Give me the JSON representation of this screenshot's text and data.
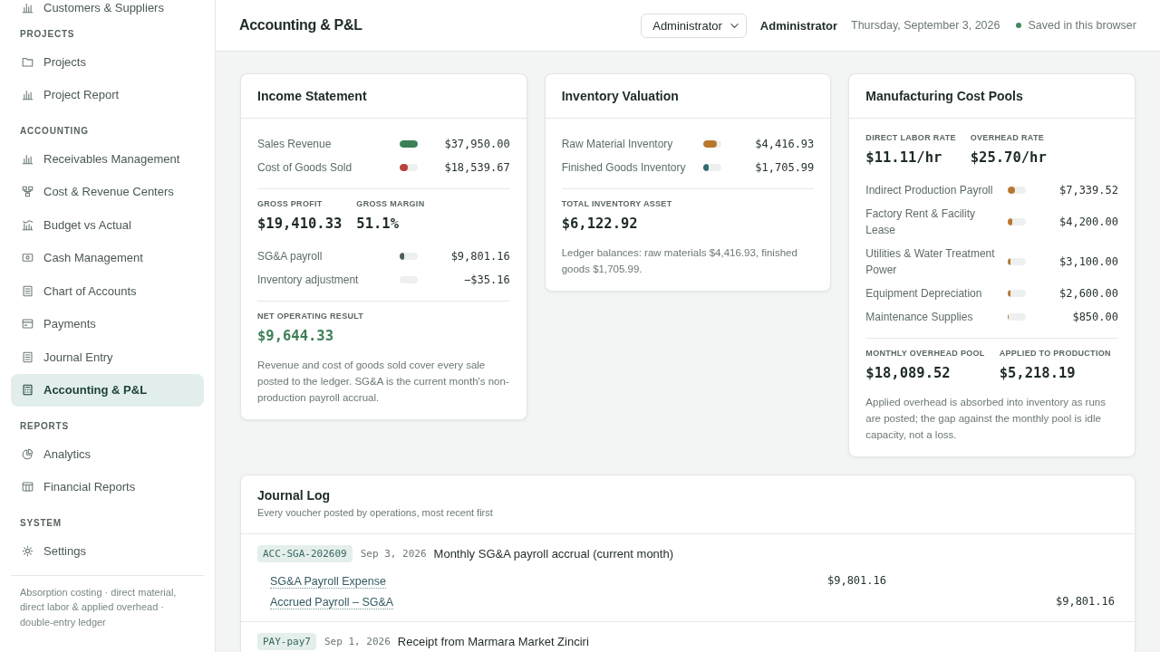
{
  "sidebar": {
    "sections": [
      {
        "items": [
          {
            "label": "Customers & Suppliers",
            "selected": false
          }
        ]
      },
      {
        "title": "PROJECTS",
        "items": [
          {
            "label": "Projects",
            "selected": false
          },
          {
            "label": "Project Report",
            "selected": false
          }
        ]
      },
      {
        "title": "ACCOUNTING",
        "items": [
          {
            "label": "Receivables Management",
            "selected": false
          },
          {
            "label": "Cost & Revenue Centers",
            "selected": false
          },
          {
            "label": "Budget vs Actual",
            "selected": false
          },
          {
            "label": "Cash Management",
            "selected": false
          },
          {
            "label": "Chart of Accounts",
            "selected": false
          },
          {
            "label": "Payments",
            "selected": false
          },
          {
            "label": "Journal Entry",
            "selected": false
          },
          {
            "label": "Accounting & P&L",
            "selected": true
          }
        ]
      },
      {
        "title": "REPORTS",
        "items": [
          {
            "label": "Analytics",
            "selected": false
          },
          {
            "label": "Financial Reports",
            "selected": false
          }
        ]
      },
      {
        "title": "SYSTEM",
        "items": [
          {
            "label": "Settings",
            "selected": false
          }
        ]
      }
    ],
    "footer": "Absorption costing · direct material, direct labor & applied overhead · double-entry ledger"
  },
  "header": {
    "title": "Accounting & P&L",
    "role_select": {
      "value": "Administrator"
    },
    "user": "Administrator",
    "date": "Thursday, September 3, 2026",
    "status": "Saved in this browser"
  },
  "cards": [
    {
      "title": "Income Statement",
      "blocks": [
        {
          "kind": "rows",
          "rows": [
            {
              "label": "Sales Revenue",
              "level": 1,
              "color": "#3d7f57",
              "value": "$37,950.00"
            },
            {
              "label": "Cost of Goods Sold",
              "level": 0.49,
              "color": "#b8433a",
              "value": "$18,539.67"
            }
          ]
        },
        {
          "kind": "stats",
          "stats": [
            {
              "label": "GROSS PROFIT",
              "value": "$19,410.33"
            },
            {
              "label": "GROSS MARGIN",
              "value": "51.1%"
            }
          ]
        },
        {
          "kind": "rows",
          "rows": [
            {
              "label": "SG&A payroll",
              "level": 0.26,
              "color": "#4f5e59",
              "value": "$9,801.16"
            },
            {
              "label": "Inventory adjustment",
              "value": "−$35.16"
            }
          ]
        },
        {
          "kind": "stats",
          "stats": [
            {
              "label": "NET OPERATING RESULT",
              "value": "$9,644.33",
              "color": "#3c7f57"
            }
          ]
        },
        {
          "kind": "note",
          "text": "Revenue and cost of goods sold cover every sale posted to the ledger. SG&A is the current month's non-production payroll accrual."
        }
      ]
    },
    {
      "title": "Inventory Valuation",
      "blocks": [
        {
          "kind": "rows",
          "rows": [
            {
              "label": "Raw Material Inventory",
              "level": 0.72,
              "color": "#b8772e",
              "value": "$4,416.93"
            },
            {
              "label": "Finished Goods Inventory",
              "level": 0.28,
              "color": "#2e6e73",
              "value": "$1,705.99"
            }
          ]
        },
        {
          "kind": "stats",
          "stats": [
            {
              "label": "TOTAL INVENTORY ASSET",
              "value": "$6,122.92"
            }
          ]
        },
        {
          "kind": "note",
          "text": "Ledger balances: raw materials $4,416.93, finished goods $1,705.99."
        }
      ]
    },
    {
      "title": "Manufacturing Cost Pools",
      "blocks": [
        {
          "kind": "stats",
          "stats": [
            {
              "label": "DIRECT LABOR RATE",
              "value": "$11.11/hr"
            },
            {
              "label": "OVERHEAD RATE",
              "value": "$25.70/hr"
            }
          ]
        },
        {
          "kind": "rows",
          "rows": [
            {
              "label": "Indirect Production Payroll",
              "level": 0.41,
              "value": "$7,339.52"
            },
            {
              "label": "Factory Rent & Facility Lease",
              "level": 0.23,
              "value": "$4,200.00"
            },
            {
              "label": "Utilities & Water Treatment Power",
              "level": 0.17,
              "value": "$3,100.00"
            },
            {
              "label": "Equipment Depreciation",
              "level": 0.14,
              "value": "$2,600.00"
            },
            {
              "label": "Maintenance Supplies",
              "level": 0.05,
              "value": "$850.00"
            }
          ]
        },
        {
          "kind": "stats",
          "stats": [
            {
              "label": "MONTHLY OVERHEAD POOL",
              "value": "$18,089.52"
            },
            {
              "label": "APPLIED TO PRODUCTION",
              "value": "$5,218.19"
            }
          ]
        },
        {
          "kind": "note",
          "text": "Applied overhead is absorbed into inventory as runs are posted; the gap against the monthly pool is idle capacity, not a loss."
        }
      ]
    }
  ],
  "journal": {
    "title": "Journal Log",
    "subtitle": "Every voucher posted by operations, most recent first",
    "entries": [
      {
        "ref": "ACC-SGA-202609",
        "date": "Sep 3, 2026",
        "description": "Monthly SG&A payroll accrual (current month)",
        "lines": [
          {
            "account": "SG&A Payroll Expense",
            "debit": "$9,801.16"
          },
          {
            "account": "Accrued Payroll – SG&A",
            "credit": "$9,801.16"
          }
        ]
      },
      {
        "ref": "PAY-pay7",
        "date": "Sep 1, 2026",
        "description": "Receipt from Marmara Market Zinciri"
      }
    ]
  }
}
